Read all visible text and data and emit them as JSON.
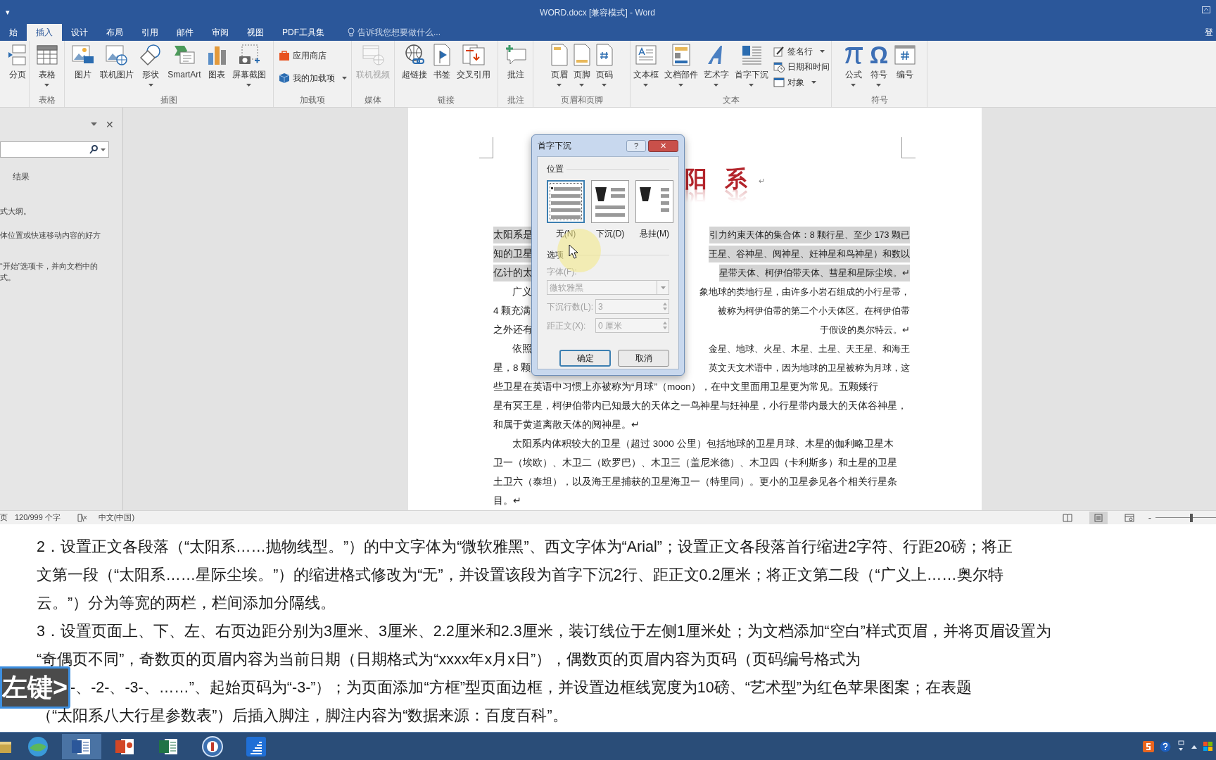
{
  "title_bar": {
    "quick_access": "▾",
    "title": "WORD.docx [兼容模式] - Word"
  },
  "tabs": [
    {
      "label": "始",
      "selected": false
    },
    {
      "label": "插入",
      "selected": true
    },
    {
      "label": "设计",
      "selected": false
    },
    {
      "label": "布局",
      "selected": false
    },
    {
      "label": "引用",
      "selected": false
    },
    {
      "label": "邮件",
      "selected": false
    },
    {
      "label": "审阅",
      "selected": false
    },
    {
      "label": "视图",
      "selected": false
    },
    {
      "label": "PDF工具集",
      "selected": false
    }
  ],
  "tell_me": {
    "placeholder": "告诉我您想要做什么..."
  },
  "account": "登",
  "ribbon": {
    "groups": [
      {
        "items": [
          {
            "label": "分页",
            "kind": "large",
            "dropdown": false,
            "disabled": false
          }
        ]
      },
      {
        "label": "表格",
        "items": [
          {
            "label": "表格",
            "kind": "large",
            "dropdown": true,
            "disabled": false
          }
        ]
      },
      {
        "label": "插图",
        "items": [
          {
            "label": "图片",
            "kind": "large",
            "dropdown": false,
            "disabled": false
          },
          {
            "label": "联机图片",
            "kind": "large",
            "dropdown": false,
            "disabled": false
          },
          {
            "label": "形状",
            "kind": "large",
            "dropdown": true,
            "disabled": false
          },
          {
            "label": "SmartArt",
            "kind": "large",
            "dropdown": false,
            "disabled": false
          },
          {
            "label": "图表",
            "kind": "large",
            "dropdown": false,
            "disabled": false
          },
          {
            "label": "屏幕截图",
            "kind": "large",
            "dropdown": true,
            "disabled": false
          }
        ]
      },
      {
        "label": "加载项",
        "items": [
          {
            "label": "应用商店",
            "kind": "small",
            "dropdown": false,
            "disabled": false
          },
          {
            "label": "我的加载项",
            "kind": "small",
            "dropdown": true,
            "disabled": false
          }
        ]
      },
      {
        "label": "媒体",
        "items": [
          {
            "label": "联机视频",
            "kind": "large",
            "dropdown": false,
            "disabled": true
          }
        ]
      },
      {
        "label": "链接",
        "items": [
          {
            "label": "超链接",
            "kind": "large",
            "dropdown": false,
            "disabled": false
          },
          {
            "label": "书签",
            "kind": "large",
            "dropdown": false,
            "disabled": false
          },
          {
            "label": "交叉引用",
            "kind": "large",
            "dropdown": false,
            "disabled": false
          }
        ]
      },
      {
        "label": "批注",
        "items": [
          {
            "label": "批注",
            "kind": "large",
            "dropdown": false,
            "disabled": false
          }
        ]
      },
      {
        "label": "页眉和页脚",
        "items": [
          {
            "label": "页眉",
            "kind": "large",
            "dropdown": true,
            "disabled": false
          },
          {
            "label": "页脚",
            "kind": "large",
            "dropdown": true,
            "disabled": false
          },
          {
            "label": "页码",
            "kind": "large",
            "dropdown": true,
            "disabled": false
          }
        ]
      },
      {
        "label": "文本",
        "items": [
          {
            "label": "文本框",
            "kind": "large",
            "dropdown": true,
            "disabled": false
          },
          {
            "label": "文档部件",
            "kind": "large",
            "dropdown": true,
            "disabled": false
          },
          {
            "label": "艺术字",
            "kind": "large",
            "dropdown": true,
            "disabled": false
          },
          {
            "label": "首字下沉",
            "kind": "large",
            "dropdown": true,
            "disabled": false
          },
          {
            "label": "签名行",
            "kind": "small",
            "dropdown": true,
            "disabled": false
          },
          {
            "label": "日期和时间",
            "kind": "small",
            "dropdown": false,
            "disabled": false
          },
          {
            "label": "对象",
            "kind": "small",
            "dropdown": true,
            "disabled": false
          }
        ]
      },
      {
        "label": "符号",
        "items": [
          {
            "label": "公式",
            "kind": "large",
            "dropdown": true,
            "disabled": false
          },
          {
            "label": "符号",
            "kind": "large",
            "dropdown": true,
            "disabled": false
          },
          {
            "label": "编号",
            "kind": "large",
            "dropdown": false,
            "disabled": false
          }
        ]
      }
    ]
  },
  "nav_pane": {
    "close": "✕",
    "results_tab": "结果",
    "help_lines": [
      "式大纲。",
      "体位置或快速移动内容的好方",
      "“开始”选项卡，并向文档中的",
      "式。"
    ]
  },
  "document": {
    "title": "阳 系",
    "title_mark": "↵",
    "lines": [
      {
        "left": "太阳系是",
        "right": "引力约束天体的集合体：8 颗行星、至少 173 颗已",
        "indent": false,
        "selected": true
      },
      {
        "left": "知的卫星",
        "right": "王星、谷神星、阋神星、妊神星和鸟神星）和数以",
        "indent": false,
        "selected": true
      },
      {
        "left": "亿计的太",
        "right": "星带天体、柯伊伯带天体、彗星和星际尘埃。↵",
        "indent": false,
        "selected": true
      },
      {
        "left": "广义",
        "right": "象地球的类地行星，由许多小岩石组成的小行星带，",
        "indent": true,
        "selected": false
      },
      {
        "left": "4 颗充满",
        "right": "被称为柯伊伯带的第二个小天体区。在柯伊伯带",
        "indent": false,
        "selected": false
      },
      {
        "left": "之外还有",
        "right": "于假设的奥尔特云。↵",
        "indent": false,
        "selected": false
      },
      {
        "left": "依照",
        "right": "金星、地球、火星、木星、土星、天王星、和海王",
        "indent": true,
        "selected": false
      },
      {
        "left": "星，8 颗",
        "right": "英文天文术语中，因为地球的卫星被称为月球，这",
        "indent": false,
        "selected": false
      },
      {
        "left": "些卫星在英语中习惯上亦被称为“月球”（moon），在中文里面用卫星更为常见。五颗矮行",
        "indent": false,
        "selected": false
      },
      {
        "left": "星有冥王星，柯伊伯带内已知最大的天体之一鸟神星与妊神星，小行星带内最大的天体谷神星，",
        "indent": false,
        "selected": false
      },
      {
        "left": "和属于黄道离散天体的阋神星。↵",
        "indent": false,
        "selected": false
      },
      {
        "left": "太阳系内体积较大的卫星（超过 3000 公里）包括地球的卫星月球、木星的伽利略卫星木",
        "indent": true,
        "selected": false
      },
      {
        "left": "卫一（埃欧）、木卫二（欧罗巴）、木卫三（盖尼米德）、木卫四（卡利斯多）和土星的卫星",
        "indent": false,
        "selected": false
      },
      {
        "left": "土卫六（泰坦），以及海王星捕获的卫星海卫一（特里同）。更小的卫星参见各个相关行星条",
        "indent": false,
        "selected": false
      },
      {
        "left": "目。↵",
        "indent": false,
        "selected": false
      }
    ]
  },
  "dialog": {
    "title": "首字下沉",
    "help": "?",
    "close": "✕",
    "position_label": "位置",
    "positions": [
      {
        "label": "无(N)",
        "selected": true
      },
      {
        "label": "下沉(D)",
        "selected": false
      },
      {
        "label": "悬挂(M)",
        "selected": false
      }
    ],
    "options_label": "选项",
    "fields": [
      {
        "label": "字体(F):",
        "value": "微软雅黑",
        "kind": "dropdown",
        "disabled": true
      },
      {
        "label": "下沉行数(L):",
        "value": "3",
        "kind": "spinner",
        "disabled": true
      },
      {
        "label": "距正文(X):",
        "value": "0 厘米",
        "kind": "spinner",
        "disabled": true
      }
    ],
    "buttons": [
      {
        "label": "确定",
        "default": true
      },
      {
        "label": "取消",
        "default": false
      }
    ]
  },
  "status_bar": {
    "page": "页",
    "words": "120/999 个字",
    "language": "中文(中国)",
    "views": [
      {
        "selected": false
      },
      {
        "selected": true
      },
      {
        "selected": false
      }
    ],
    "zoom_out": "-",
    "zoom": {
      "level": 0.57
    }
  },
  "instructions": {
    "lines": [
      {
        "text": "2．设置正文各段落（“太阳系……抛物线型。”）的中文字体为“微软雅黑”、西文字体为“Arial”；设置正文各段落首行缩进2字符、行距20磅；将正"
      },
      {
        "text": "文第一段（“太阳系……星际尘埃。”）的缩进格式修改为“无”，并设置该段为首字下沉2行、距正文0.2厘米；将正文第二段（“广义上……奥尔特"
      },
      {
        "text": "云。”）分为等宽的两栏，栏间添加分隔线。"
      },
      {
        "text": "3．设置页面上、下、左、右页边距分别为3厘米、3厘米、2.2厘米和2.3厘米，装订线位于左侧1厘米处；为文档添加“空白”样式页眉，并将页眉设置为"
      },
      {
        "text": "“奇偶页不同”，奇数页的页眉内容为当前日期（日期格式为“xxxx年x月x日”），偶数页的页眉内容为页码（页码编号格式为"
      },
      {
        "text": "-、-2-、-3-、……”、起始页码为“-3-”）；为页面添加“方框”型页面边框，并设置边框线宽度为10磅、“艺术型”为红色苹果图案；在表题",
        "overlay": "左键>"
      },
      {
        "text": "（“太阳系八大行星参数表”）后插入脚注，脚注内容为“数据来源：百度百科”。"
      }
    ]
  }
}
